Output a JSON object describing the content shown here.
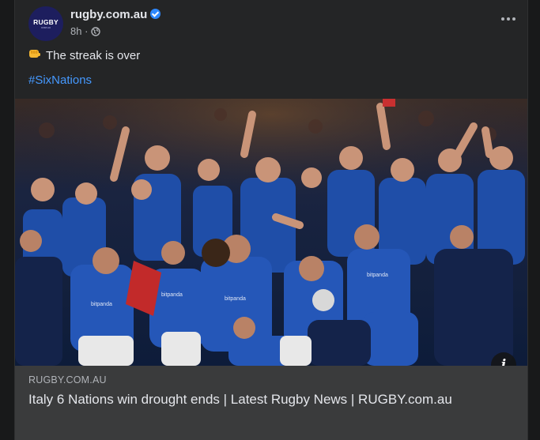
{
  "post": {
    "page_name": "rugby.com.au",
    "avatar_text": "RUGBY",
    "avatar_subtext": "COM.AU",
    "time": "8h",
    "separator": "·",
    "text": "The streak is over",
    "hashtag": "#SixNations"
  },
  "link_preview": {
    "domain": "RUGBY.COM.AU",
    "title": "Italy 6 Nations win drought ends | Latest Rugby News | RUGBY.com.au"
  },
  "colors": {
    "background": "#18191a",
    "card": "#242526",
    "link_box": "#3a3b3c",
    "hashtag": "#4599ff",
    "verified": "#2d88ff",
    "jersey_blue": "#1d4fa8"
  },
  "icons": [
    "verified-badge-icon",
    "globe-icon",
    "more-options-icon",
    "fist-emoji-icon",
    "info-icon"
  ]
}
